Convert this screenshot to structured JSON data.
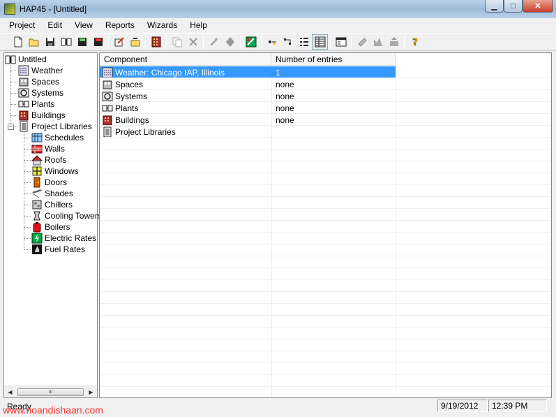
{
  "window": {
    "title": "HAP45 - [Untitled]"
  },
  "menu": [
    "Project",
    "Edit",
    "View",
    "Reports",
    "Wizards",
    "Help"
  ],
  "toolbar": {
    "icons": [
      "new-file-icon",
      "open-folder-icon",
      "save-icon",
      "open-book-icon",
      "save-as-icon",
      "save-red-icon",
      "|",
      "edit-properties-icon",
      "new-item-icon",
      "|",
      "building-icon",
      "|",
      "copy-icon",
      "delete-icon",
      "|",
      "wizard-icon",
      "duplicate-icon",
      "|",
      "calculate-icon",
      "|",
      "large-icons-view-icon",
      "small-icons-view-icon",
      "list-view-icon",
      "details-view-icon",
      "|",
      "report-icon",
      "|",
      "print-icon",
      "graph-icon",
      "export-icon",
      "|",
      "help-icon"
    ]
  },
  "tree": {
    "root": "Untitled",
    "items": [
      {
        "label": "Weather",
        "icon": "weather-icon",
        "level": 1
      },
      {
        "label": "Spaces",
        "icon": "spaces-icon",
        "level": 1
      },
      {
        "label": "Systems",
        "icon": "systems-icon",
        "level": 1
      },
      {
        "label": "Plants",
        "icon": "plants-icon",
        "level": 1
      },
      {
        "label": "Buildings",
        "icon": "buildings-icon",
        "level": 1
      },
      {
        "label": "Project Libraries",
        "icon": "project-libraries-icon",
        "level": 1,
        "expanded": true
      },
      {
        "label": "Schedules",
        "icon": "schedules-icon",
        "level": 2
      },
      {
        "label": "Walls",
        "icon": "walls-icon",
        "level": 2
      },
      {
        "label": "Roofs",
        "icon": "roofs-icon",
        "level": 2
      },
      {
        "label": "Windows",
        "icon": "windows-icon",
        "level": 2
      },
      {
        "label": "Doors",
        "icon": "doors-icon",
        "level": 2
      },
      {
        "label": "Shades",
        "icon": "shades-icon",
        "level": 2
      },
      {
        "label": "Chillers",
        "icon": "chillers-icon",
        "level": 2
      },
      {
        "label": "Cooling Towers",
        "icon": "cooling-towers-icon",
        "level": 2
      },
      {
        "label": "Boilers",
        "icon": "boilers-icon",
        "level": 2
      },
      {
        "label": "Electric Rates",
        "icon": "electric-rates-icon",
        "level": 2
      },
      {
        "label": "Fuel Rates",
        "icon": "fuel-rates-icon",
        "level": 2
      }
    ],
    "scroll_thumb": "III"
  },
  "list": {
    "columns": [
      "Component",
      "Number of entries"
    ],
    "rows": [
      {
        "component": "Weather: Chicago IAP, Illinois",
        "entries": "1",
        "icon": "weather-icon",
        "selected": true
      },
      {
        "component": "Spaces",
        "entries": "none",
        "icon": "spaces-icon"
      },
      {
        "component": "Systems",
        "entries": "none",
        "icon": "systems-icon"
      },
      {
        "component": "Plants",
        "entries": "none",
        "icon": "plants-icon"
      },
      {
        "component": "Buildings",
        "entries": "none",
        "icon": "buildings-icon"
      },
      {
        "component": "Project Libraries",
        "entries": "",
        "icon": "project-libraries-icon"
      }
    ]
  },
  "status": {
    "text": "Ready",
    "date": "9/19/2012",
    "time": "12:39 PM"
  },
  "watermark": "www.noandishaan.com",
  "colors": {
    "selection": "#3399ff",
    "watermark": "#ff3030"
  }
}
